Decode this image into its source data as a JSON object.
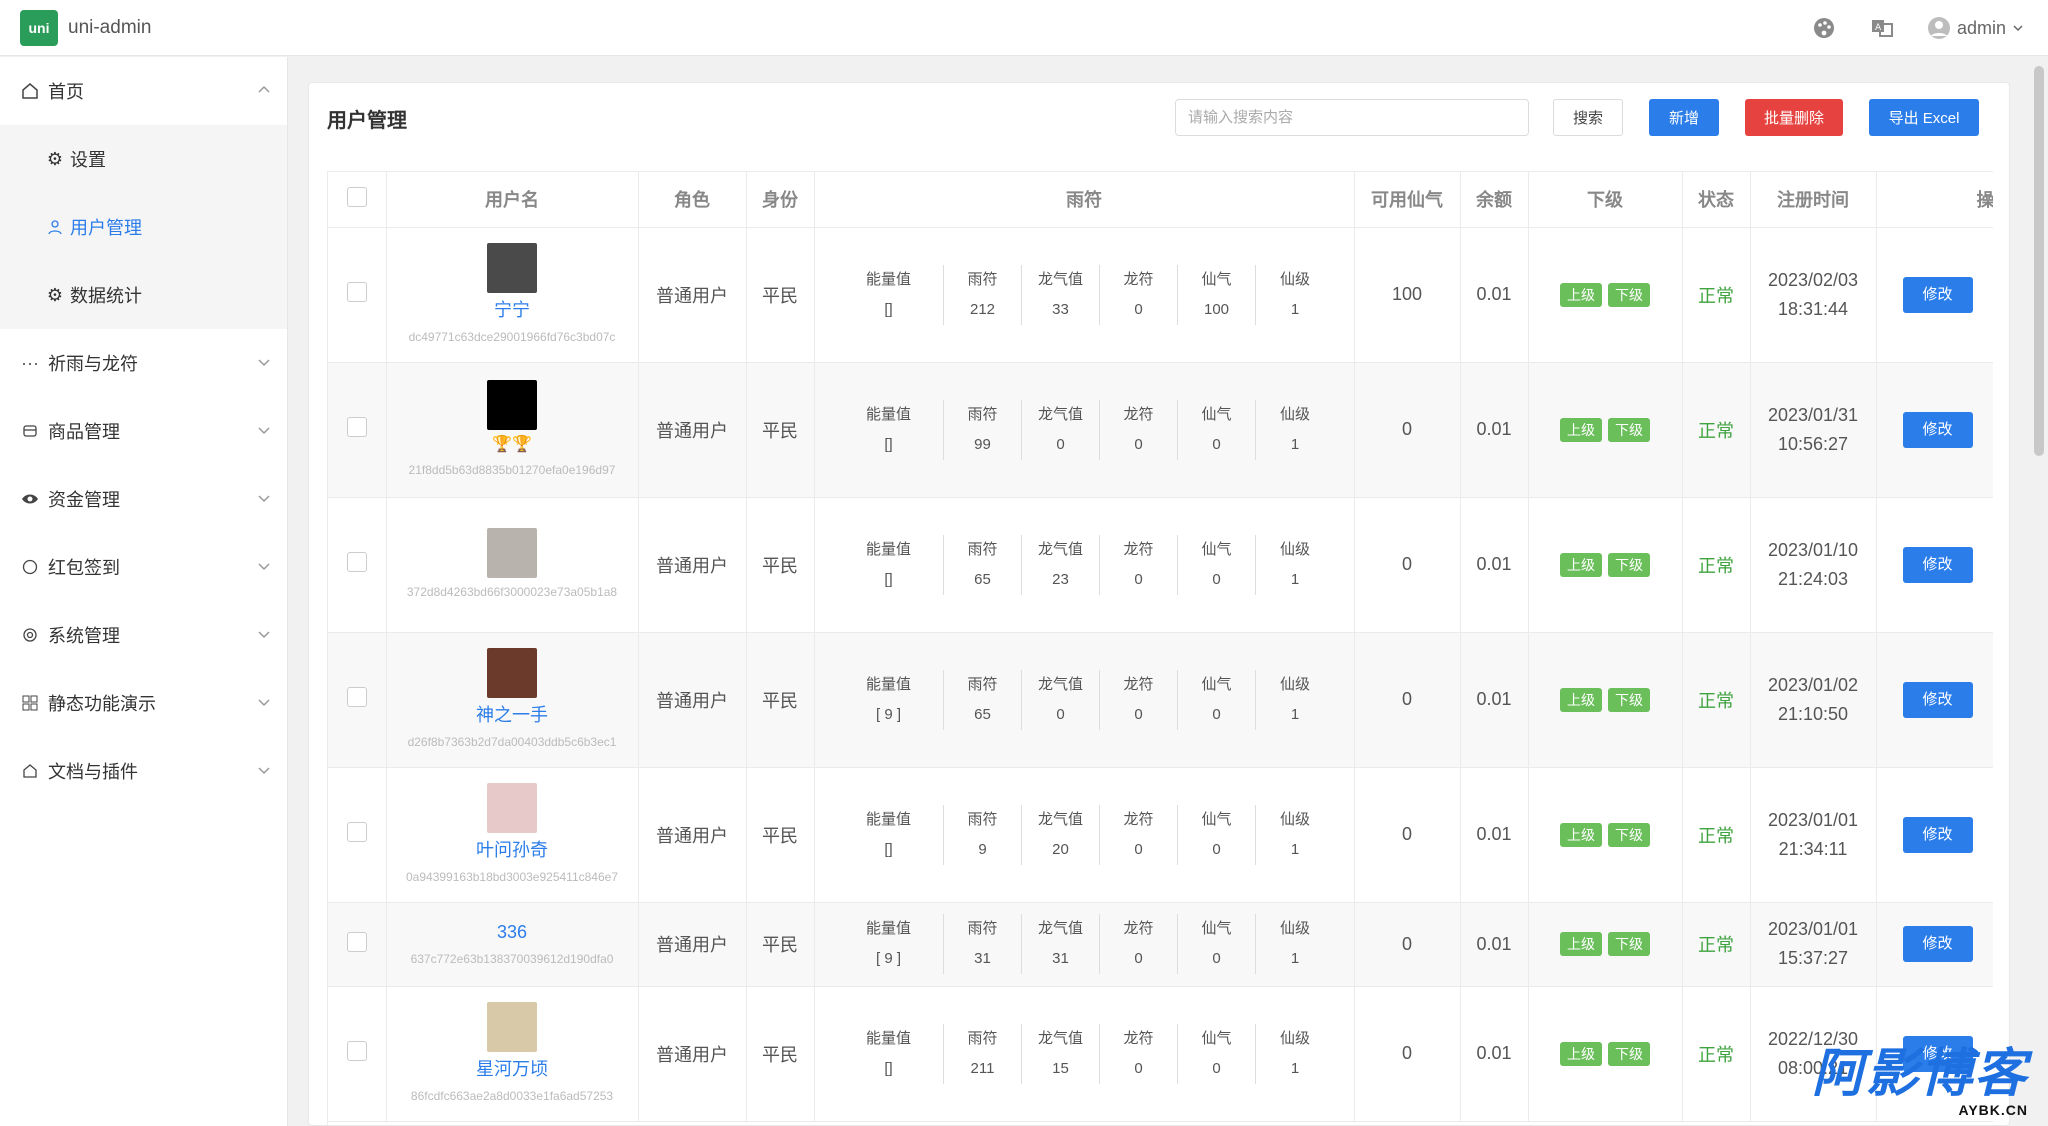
{
  "app": {
    "logo_text": "uni",
    "title": "uni-admin",
    "brand_color": "#2a9d5a",
    "accent_color": "#2b7de9"
  },
  "header": {
    "user_name": "admin",
    "icons": [
      "palette-icon",
      "translate-icon",
      "user-avatar-icon"
    ]
  },
  "sidebar": {
    "items": [
      {
        "label": "首页",
        "icon": "home-icon",
        "expanded": true
      },
      {
        "label": "祈雨与龙符",
        "icon": "ellipsis-icon"
      },
      {
        "label": "商品管理",
        "icon": "goods-icon"
      },
      {
        "label": "资金管理",
        "icon": "eye-icon"
      },
      {
        "label": "红包签到",
        "icon": "circle-icon"
      },
      {
        "label": "系统管理",
        "icon": "gear-icon"
      },
      {
        "label": "静态功能演示",
        "icon": "grid-icon"
      },
      {
        "label": "文档与插件",
        "icon": "plugin-icon"
      }
    ],
    "subitems": [
      {
        "label": "设置",
        "icon": "gear-icon"
      },
      {
        "label": "用户管理",
        "icon": "user-icon",
        "active": true
      },
      {
        "label": "数据统计",
        "icon": "gear-icon"
      }
    ]
  },
  "main": {
    "title": "用户管理",
    "search_placeholder": "请输入搜索内容",
    "search_label": "搜索",
    "add_label": "新增",
    "batch_delete_label": "批量删除",
    "export_label": "导出 Excel"
  },
  "table": {
    "headers": [
      "用户名",
      "角色",
      "身份",
      "雨符",
      "可用仙气",
      "余额",
      "下级",
      "状态",
      "注册时间",
      "操作"
    ],
    "attr_keys": [
      "能量值",
      "雨符",
      "龙气值",
      "龙符",
      "仙气",
      "仙级"
    ],
    "sub_labels": [
      "上级",
      "下级"
    ],
    "edit_label": "修改",
    "rows": [
      {
        "name": "宁宁",
        "id": "dc49771c63dce29001966fd76c3bd07c",
        "role": "普通用户",
        "identity": "平民",
        "attrs": [
          "[]",
          "212",
          "33",
          "0",
          "100",
          "1"
        ],
        "xianqi": "100",
        "balance": "0.01",
        "status": "正常",
        "date": "2023/02/03",
        "time": "18:31:44",
        "avatar_color": "#4a4a4a"
      },
      {
        "name": "",
        "trophy": "🏆🏆",
        "id": "21f8dd5b63d8835b01270efa0e196d97",
        "role": "普通用户",
        "identity": "平民",
        "attrs": [
          "[]",
          "99",
          "0",
          "0",
          "0",
          "1"
        ],
        "xianqi": "0",
        "balance": "0.01",
        "status": "正常",
        "date": "2023/01/31",
        "time": "10:56:27",
        "avatar_color": "#000000"
      },
      {
        "name": "",
        "id": "372d8d4263bd66f3000023e73a05b1a8",
        "role": "普通用户",
        "identity": "平民",
        "attrs": [
          "[]",
          "65",
          "23",
          "0",
          "0",
          "1"
        ],
        "xianqi": "0",
        "balance": "0.01",
        "status": "正常",
        "date": "2023/01/10",
        "time": "21:24:03",
        "avatar_color": "#b9b3ad"
      },
      {
        "name": "神之一手",
        "id": "d26f8b7363b2d7da00403ddb5c6b3ec1",
        "role": "普通用户",
        "identity": "平民",
        "attrs": [
          "[ 9 ]",
          "65",
          "0",
          "0",
          "0",
          "1"
        ],
        "xianqi": "0",
        "balance": "0.01",
        "status": "正常",
        "date": "2023/01/02",
        "time": "21:10:50",
        "avatar_color": "#6b3a2a"
      },
      {
        "name": "叶问孙奇",
        "id": "0a94399163b18bd3003e925411c846e7",
        "role": "普通用户",
        "identity": "平民",
        "attrs": [
          "[]",
          "9",
          "20",
          "0",
          "0",
          "1"
        ],
        "xianqi": "0",
        "balance": "0.01",
        "status": "正常",
        "date": "2023/01/01",
        "time": "21:34:11",
        "avatar_color": "#e8c9c9"
      },
      {
        "name": "336",
        "id": "637c772e63b138370039612d190dfa0",
        "role": "普通用户",
        "identity": "平民",
        "attrs": [
          "[ 9 ]",
          "31",
          "31",
          "0",
          "0",
          "1"
        ],
        "xianqi": "0",
        "balance": "0.01",
        "status": "正常",
        "date": "2023/01/01",
        "time": "15:37:27",
        "avatar_color": ""
      },
      {
        "name": "星河万顷",
        "id": "86fcdfc663ae2a8d0033e1fa6ad57253",
        "role": "普通用户",
        "identity": "平民",
        "attrs": [
          "[]",
          "211",
          "15",
          "0",
          "0",
          "1"
        ],
        "xianqi": "0",
        "balance": "0.01",
        "status": "正常",
        "date": "2022/12/30",
        "time": "08:00:21",
        "avatar_color": "#d8c9a8"
      }
    ]
  },
  "watermark": {
    "big": "阿影博客",
    "small": "AYBK.CN"
  }
}
